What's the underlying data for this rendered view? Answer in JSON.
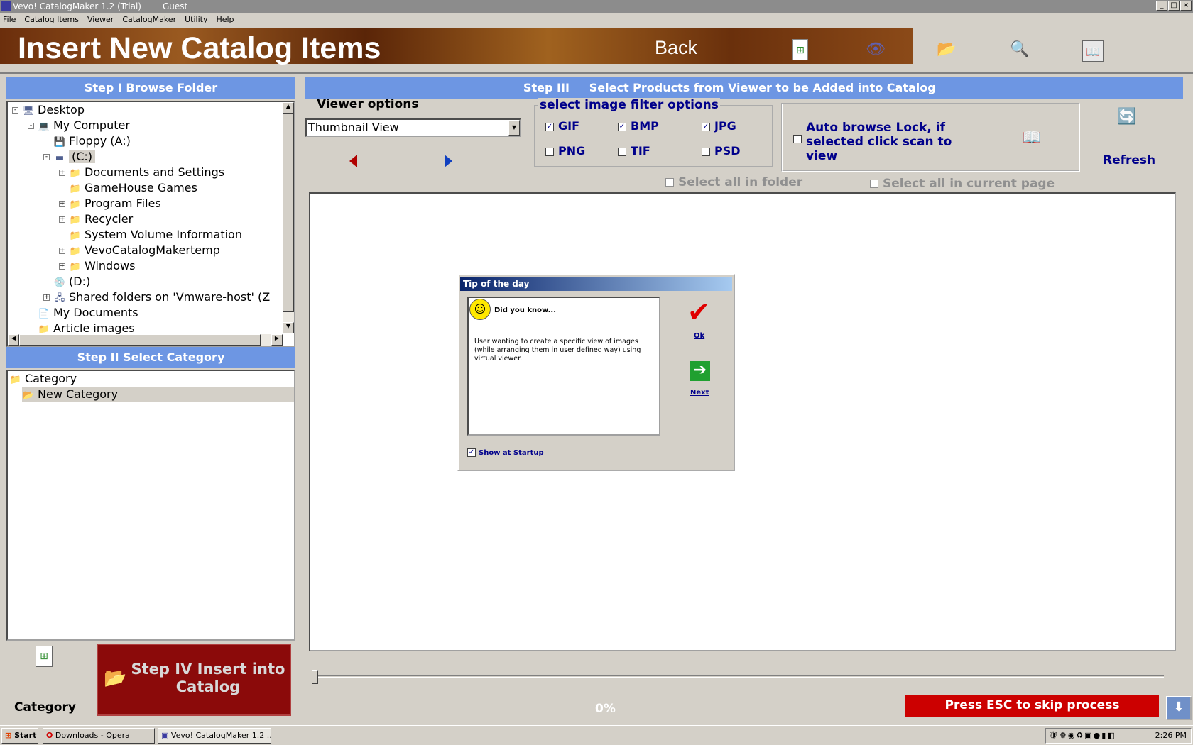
{
  "window": {
    "title": "Vevo! CatalogMaker 1.2 (Trial)",
    "user": "Guest",
    "controls": [
      "_",
      "□",
      "×"
    ]
  },
  "menu": [
    "File",
    "Catalog Items",
    "Viewer",
    "CatalogMaker",
    "Utility",
    "Help"
  ],
  "banner": {
    "title": "Insert New Catalog Items",
    "back": "Back"
  },
  "step1": {
    "title": "Step I  Browse  Folder",
    "tree": [
      {
        "label": "Desktop",
        "icon": "desktop-icon",
        "glyph": "🖥",
        "level": 0,
        "expander": "-"
      },
      {
        "label": "My Computer",
        "icon": "computer-icon",
        "glyph": "💻",
        "level": 1,
        "expander": "-"
      },
      {
        "label": "Floppy (A:)",
        "icon": "floppy-icon",
        "glyph": "💾",
        "level": 2,
        "expander": ""
      },
      {
        "label": "(C:)",
        "icon": "drive-icon",
        "glyph": "▬",
        "level": 2,
        "expander": "-",
        "selected": true
      },
      {
        "label": "Documents and Settings",
        "icon": "folder-icon",
        "glyph": "📁",
        "level": 3,
        "expander": "+"
      },
      {
        "label": "GameHouse Games",
        "icon": "folder-icon",
        "glyph": "📁",
        "level": 3,
        "expander": ""
      },
      {
        "label": "Program Files",
        "icon": "folder-icon",
        "glyph": "📁",
        "level": 3,
        "expander": "+"
      },
      {
        "label": "Recycler",
        "icon": "folder-icon",
        "glyph": "📁",
        "level": 3,
        "expander": "+"
      },
      {
        "label": "System Volume Information",
        "icon": "folder-icon",
        "glyph": "📁",
        "level": 3,
        "expander": ""
      },
      {
        "label": "VevoCatalogMakertemp",
        "icon": "folder-icon",
        "glyph": "📁",
        "level": 3,
        "expander": "+"
      },
      {
        "label": "Windows",
        "icon": "folder-icon",
        "glyph": "📁",
        "level": 3,
        "expander": "+"
      },
      {
        "label": "(D:)",
        "icon": "cd-drive-icon",
        "glyph": "💿",
        "level": 2,
        "expander": ""
      },
      {
        "label": "Shared folders on 'Vmware-host' (Z",
        "icon": "network-drive-icon",
        "glyph": "🖧",
        "level": 2,
        "expander": "+"
      },
      {
        "label": "My Documents",
        "icon": "documents-icon",
        "glyph": "📄",
        "level": 1,
        "expander": ""
      },
      {
        "label": "Article images",
        "icon": "folder-icon",
        "glyph": "📁",
        "level": 1,
        "expander": ""
      }
    ]
  },
  "step2": {
    "title": "Step II  Select Category",
    "tree": [
      {
        "label": "Category",
        "level": 0
      },
      {
        "label": "New Category",
        "level": 1,
        "selected": true
      }
    ]
  },
  "bottom_left": {
    "category_label": "Category",
    "step4": "Step IV Insert into Catalog"
  },
  "step3": {
    "title": "Step III     Select Products from Viewer to be Added into Catalog",
    "viewer_options_label": "Viewer  options",
    "viewer_select": "Thumbnail View",
    "filter_title": "select image filter options",
    "filters": [
      {
        "label": "GIF",
        "checked": true
      },
      {
        "label": "BMP",
        "checked": true
      },
      {
        "label": "JPG",
        "checked": true
      },
      {
        "label": "PNG",
        "checked": false
      },
      {
        "label": "TIF",
        "checked": false
      },
      {
        "label": "PSD",
        "checked": false
      }
    ],
    "auto_browse": "Auto browse Lock, if selected click scan to view",
    "auto_browse_checked": false,
    "refresh": "Refresh",
    "select_all_folder": "Select all in folder",
    "select_all_page": "Select all in current page",
    "progress": "0%",
    "esc_text": "Press ESC to skip process"
  },
  "dialog": {
    "title": "Tip of the day",
    "heading": "Did you know...",
    "body": "User wanting to create a specific view of images (while arranging them in user defined way) using virtual viewer.",
    "ok": "Ok",
    "next": "Next",
    "show_startup": "Show at Startup",
    "show_startup_checked": true
  },
  "taskbar": {
    "start": "Start",
    "tasks": [
      "Downloads - Opera",
      "Vevo! CatalogMaker 1.2 ..."
    ],
    "clock": "2:26 PM"
  },
  "colors": {
    "header": "#6d96e3",
    "banner": "#7a3a10",
    "step4": "#8b0a0a",
    "esc": "#cc0000",
    "label": "#00008b"
  }
}
